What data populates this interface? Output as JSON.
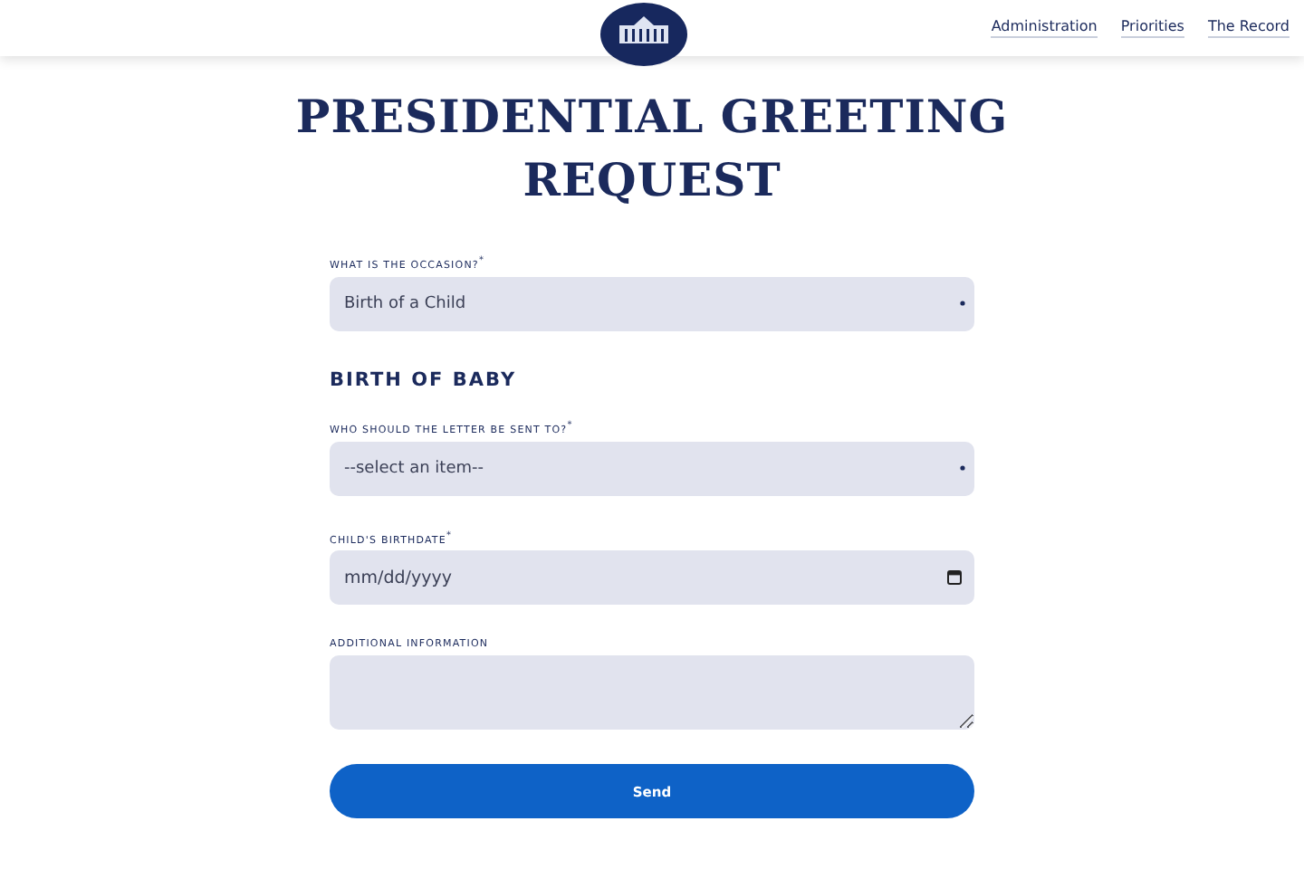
{
  "header": {
    "nav": [
      {
        "label": "Administration"
      },
      {
        "label": "Priorities"
      },
      {
        "label": "The Record"
      }
    ]
  },
  "title": [
    "PRESIDENTIAL GREETING",
    "REQUEST"
  ],
  "form": {
    "fields": [
      {
        "kind": "select",
        "label": "WHAT IS THE OCCASION?$^{*}$",
        "value": "Birth of a Child"
      },
      {
        "kind": "heading",
        "label": "BIRTH OF BABY"
      },
      {
        "kind": "select",
        "label": "WHO SHOULD THE LETTER BE SENT TO?$^{*}$",
        "value": "--select an item--"
      },
      {
        "kind": "date",
        "label": "CHILD'S BIRTHDATE$^{*}$",
        "placeholder": "mm/dd/yyyy"
      },
      {
        "kind": "textarea",
        "label": "ADDITIONAL INFORMATION"
      }
    ],
    "submit": "Send"
  }
}
